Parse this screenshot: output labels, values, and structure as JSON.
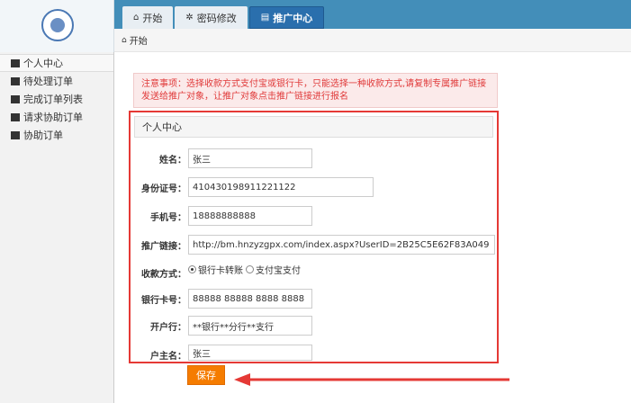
{
  "tabs": [
    {
      "label": "开始",
      "icon": "home-icon"
    },
    {
      "label": "密码修改",
      "icon": "gear-icon"
    },
    {
      "label": "推广中心",
      "icon": "document-icon",
      "active": true
    }
  ],
  "breadcrumb": {
    "label": "开始"
  },
  "sidebar": {
    "items": [
      {
        "label": "个人中心"
      },
      {
        "label": "待处理订单"
      },
      {
        "label": "完成订单列表"
      },
      {
        "label": "请求协助订单"
      },
      {
        "label": "协助订单"
      }
    ]
  },
  "notice": {
    "text": "注意事项：选择收款方式支付宝或银行卡，只能选择一种收款方式,请复制专属推广链接发送给推广对象，让推广对象点击推广链接进行报名"
  },
  "panel": {
    "title": "个人中心",
    "fields": {
      "name": {
        "label": "姓名：",
        "value": "张三"
      },
      "idcard": {
        "label": "身份证号：",
        "value": "410430198911221122"
      },
      "phone": {
        "label": "手机号：",
        "value": "18888888888"
      },
      "link": {
        "label": "推广链接：",
        "value": "http://bm.hnzyzgpx.com/index.aspx?UserID=2B25C5E62F83A049"
      },
      "payment": {
        "label": "收款方式：",
        "option_bank": "银行卡转账",
        "option_alipay": "支付宝支付"
      },
      "bankcard": {
        "label": "银行卡号：",
        "value": "88888 88888 8888 8888"
      },
      "bank": {
        "label": "开户行：",
        "value": "**银行**分行**支行"
      },
      "holder": {
        "label": "户主名：",
        "value": "张三"
      }
    }
  },
  "actions": {
    "save_label": "保存"
  },
  "colors": {
    "accent": "#2a6fad",
    "highlight_border": "#e53935",
    "save_button": "#f57c00",
    "notice_text": "#e03a3a"
  }
}
